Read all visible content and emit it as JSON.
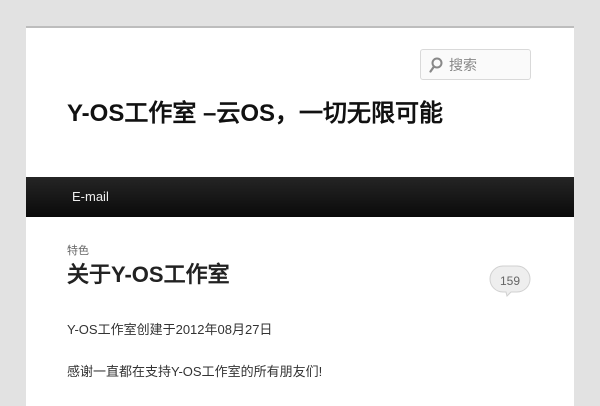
{
  "search": {
    "placeholder": "搜索",
    "icon": "search-icon"
  },
  "site": {
    "title": "Y-OS工作室 –云OS，一切无限可能"
  },
  "nav": {
    "items": [
      {
        "label": "E-mail"
      }
    ]
  },
  "post": {
    "category_label": "特色",
    "title": "关于Y-OS工作室",
    "comment_count": "159",
    "paragraphs": [
      "Y-OS工作室创建于2012年08月27日",
      "感谢一直都在支持Y-OS工作室的所有朋友们!"
    ]
  }
}
